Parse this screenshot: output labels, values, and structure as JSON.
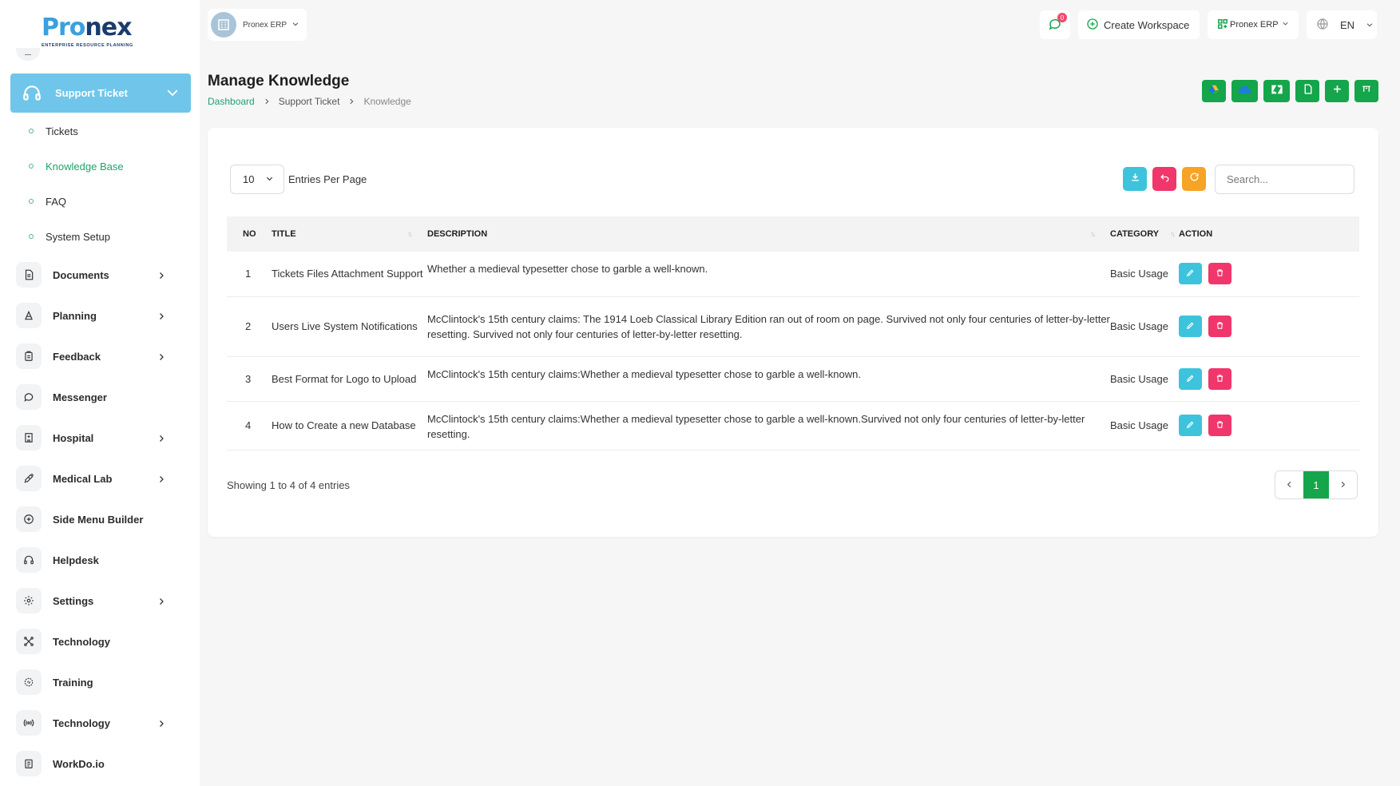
{
  "brand": {
    "logo_text_p": "P",
    "logo_text_ro": "ro",
    "logo_text_nex": "nex",
    "tagline": "ENTERPRISE RESOURCE PLANNING"
  },
  "sidebar": {
    "active": {
      "label": "Support Ticket",
      "icon": "headset-icon"
    },
    "sub_items": [
      {
        "label": "Tickets"
      },
      {
        "label": "Knowledge Base"
      },
      {
        "label": "FAQ"
      },
      {
        "label": "System Setup"
      }
    ],
    "menu": [
      {
        "label": "Documents",
        "icon": "document-icon",
        "has_children": true
      },
      {
        "label": "Planning",
        "icon": "planning-icon",
        "has_children": true
      },
      {
        "label": "Feedback",
        "icon": "clipboard-icon",
        "has_children": true
      },
      {
        "label": "Messenger",
        "icon": "chat-icon",
        "has_children": false
      },
      {
        "label": "Hospital",
        "icon": "hospital-icon",
        "has_children": true
      },
      {
        "label": "Medical Lab",
        "icon": "syringe-icon",
        "has_children": true
      },
      {
        "label": "Side Menu Builder",
        "icon": "plus-circle-icon",
        "has_children": false
      },
      {
        "label": "Helpdesk",
        "icon": "headphones-icon",
        "has_children": false
      },
      {
        "label": "Settings",
        "icon": "gear-icon",
        "has_children": true
      },
      {
        "label": "Technology",
        "icon": "network-icon",
        "has_children": false
      },
      {
        "label": "Training",
        "icon": "training-icon",
        "has_children": false
      },
      {
        "label": "Technology",
        "icon": "broadcast-icon",
        "has_children": true
      },
      {
        "label": "WorkDo.io",
        "icon": "notes-icon",
        "has_children": false
      }
    ]
  },
  "header": {
    "workspace_name": "Pronex ERP",
    "notification_count": "0",
    "create_workspace_label": "Create Workspace",
    "erp_select_label": "Pronex ERP",
    "language": "EN"
  },
  "page": {
    "title": "Manage Knowledge",
    "breadcrumb": [
      "Dashboard",
      "Support Ticket",
      "Knowledge"
    ]
  },
  "table_controls": {
    "entries_value": "10",
    "entries_label": "Entries Per Page",
    "search_placeholder": "Search..."
  },
  "table": {
    "columns": [
      "NO",
      "TITLE",
      "DESCRIPTION",
      "CATEGORY",
      "ACTION"
    ],
    "rows": [
      {
        "no": "1",
        "title": "Tickets Files Attachment Support",
        "description": "Whether a medieval typesetter chose to garble a well-known.",
        "category": "Basic Usage"
      },
      {
        "no": "2",
        "title": "Users Live System Notifications",
        "description": "McClintock's 15th century claims: The 1914 Loeb Classical Library Edition ran out of room on page. Survived not only four centuries of letter-by-letter resetting. Survived not only four centuries of letter-by-letter resetting.",
        "category": "Basic Usage"
      },
      {
        "no": "3",
        "title": "Best Format for Logo to Upload",
        "description": "McClintock's 15th century claims:Whether a medieval typesetter chose to garble a well-known.",
        "category": "Basic Usage"
      },
      {
        "no": "4",
        "title": "How to Create a new Database",
        "description": "McClintock's 15th century claims:Whether a medieval typesetter chose to garble a well-known.Survived not only four centuries of letter-by-letter resetting.",
        "category": "Basic Usage"
      }
    ]
  },
  "footer": {
    "showing_text": "Showing 1 to 4 of 4 entries",
    "current_page": "1"
  },
  "colors": {
    "primary_green": "#15a54a",
    "link_green": "#1fa26c",
    "active_blue": "#6fc6ea",
    "edit_cyan": "#3ec3dc",
    "delete_pink": "#f0366a",
    "undo_pink": "#f0366a",
    "reload_orange": "#f7a325"
  }
}
